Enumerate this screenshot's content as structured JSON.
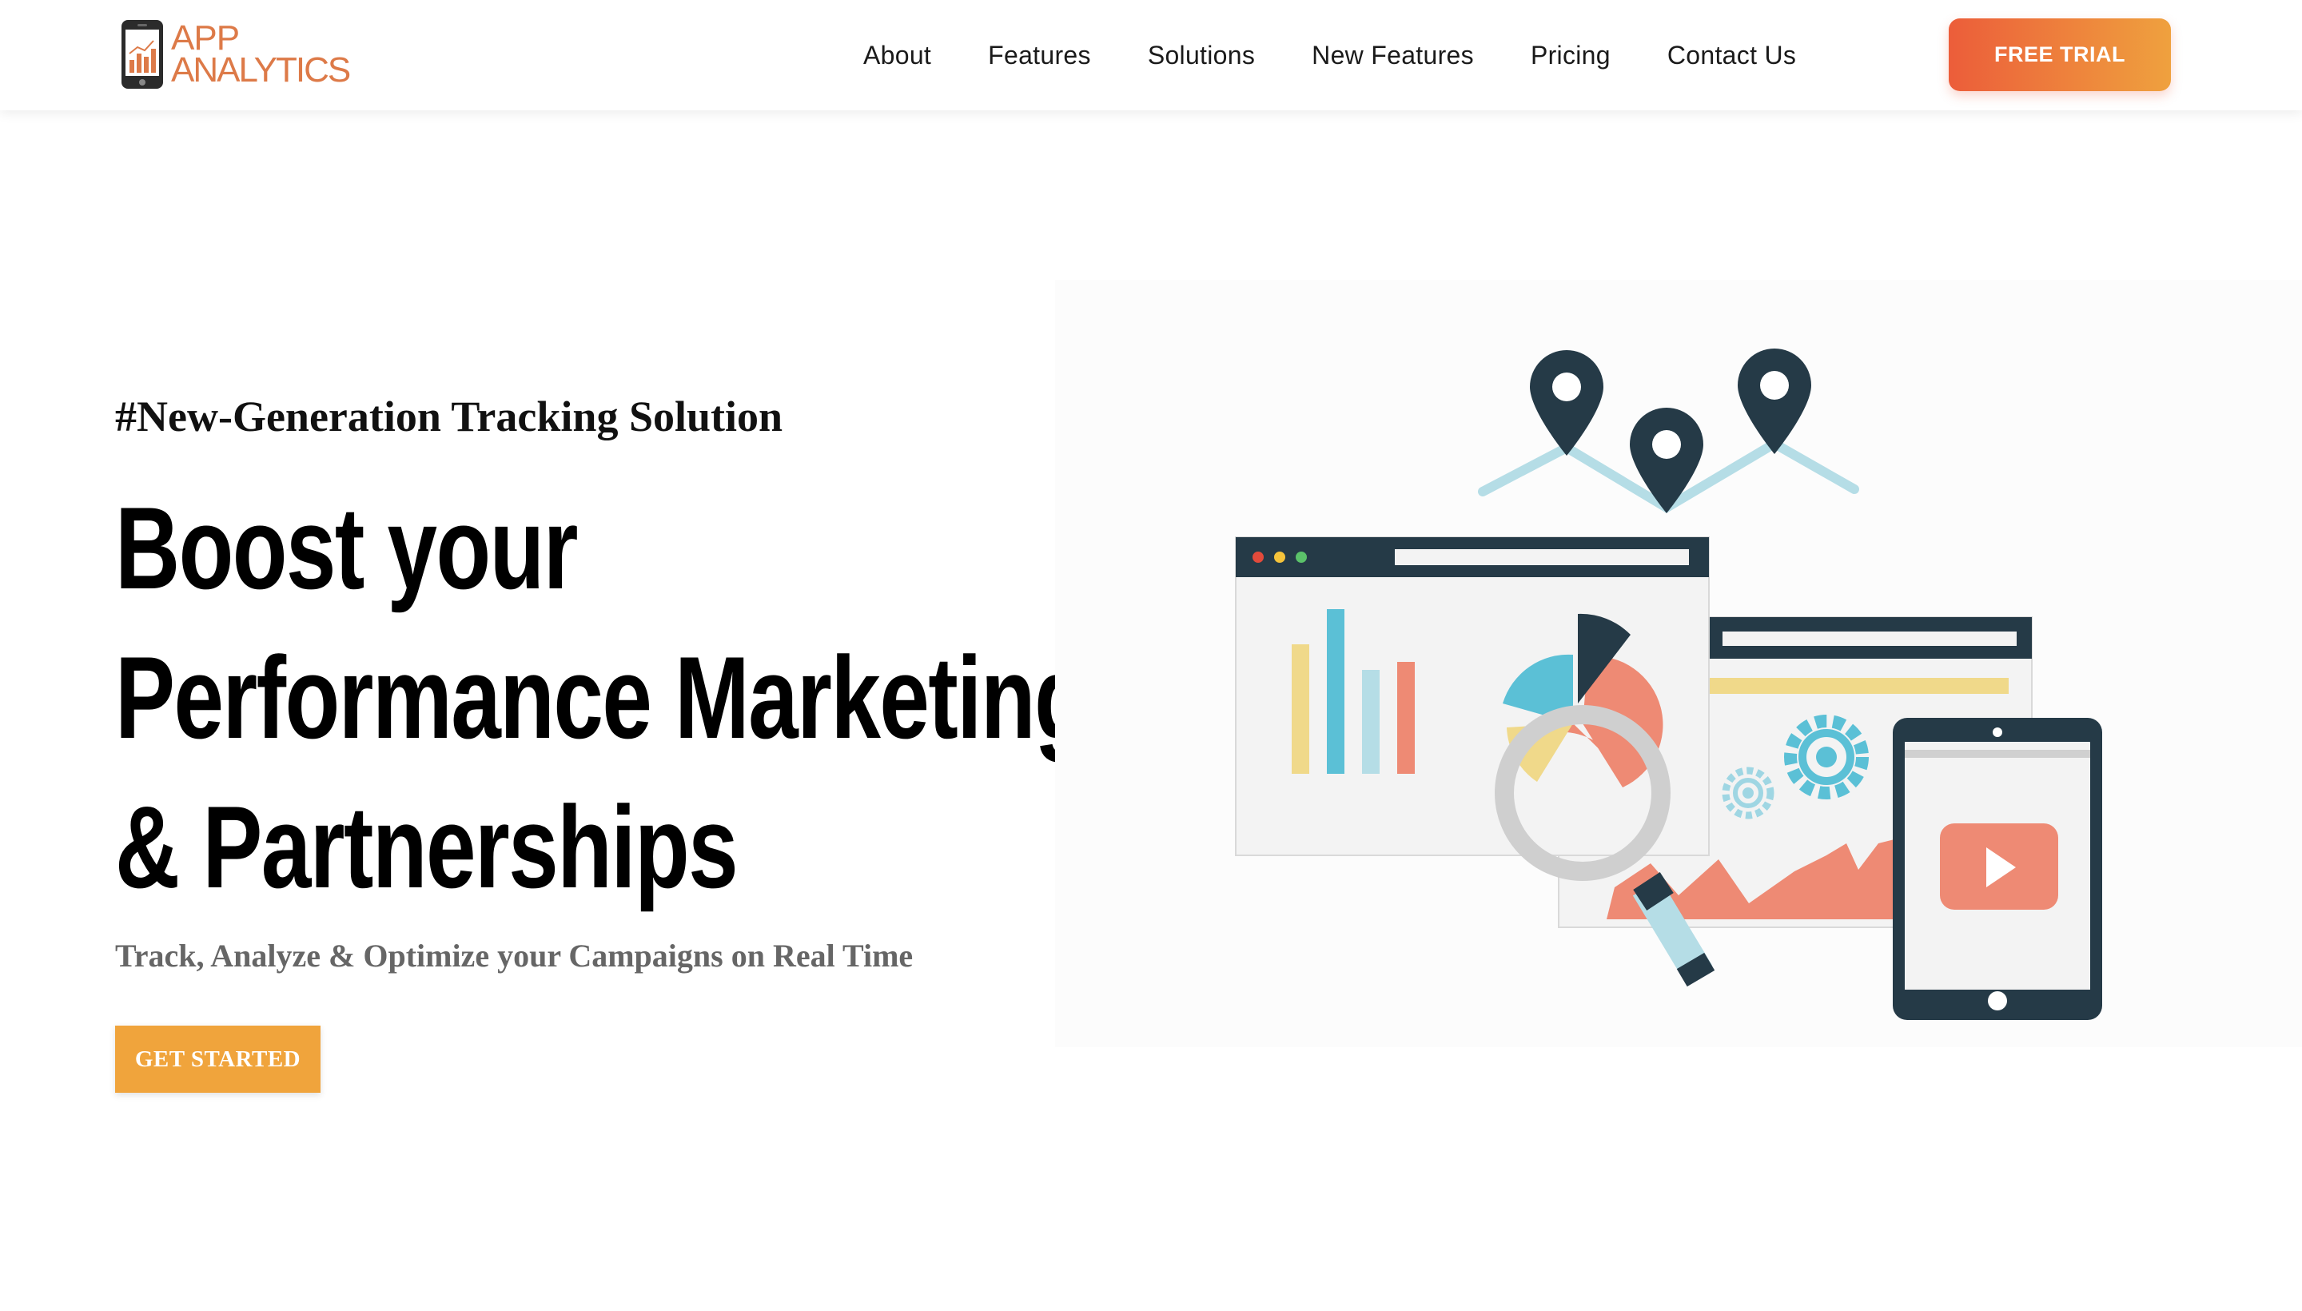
{
  "brand": {
    "line1": "APP",
    "line2": "ANALYTICS",
    "color": "#dd7a48"
  },
  "nav": {
    "items": [
      {
        "label": "About"
      },
      {
        "label": "Features"
      },
      {
        "label": "Solutions"
      },
      {
        "label": "New Features"
      },
      {
        "label": "Pricing"
      },
      {
        "label": "Contact Us"
      }
    ],
    "cta_label": "FREE TRIAL"
  },
  "hero": {
    "tagline": "#New-Generation Tracking Solution",
    "headline": [
      "Boost your",
      "Performance Marketing",
      "& Partnerships"
    ],
    "subtitle": "Track, Analyze & Optimize your Campaigns on Real Time",
    "cta_label": "GET STARTED"
  },
  "colors": {
    "accent_orange": "#f0a43c",
    "gradient_start": "#ec5d3a",
    "gradient_end": "#efa13e",
    "dark_navy": "#253a47",
    "teal": "#5bc0d6",
    "salmon": "#ee8a74",
    "yellow": "#f0d98a"
  },
  "illustration": {
    "icons": [
      "map-pin-icon",
      "browser-window-icon",
      "bar-chart-icon",
      "pie-chart-icon",
      "magnifier-icon",
      "gear-icon",
      "tablet-icon",
      "play-icon",
      "area-chart-icon"
    ]
  }
}
